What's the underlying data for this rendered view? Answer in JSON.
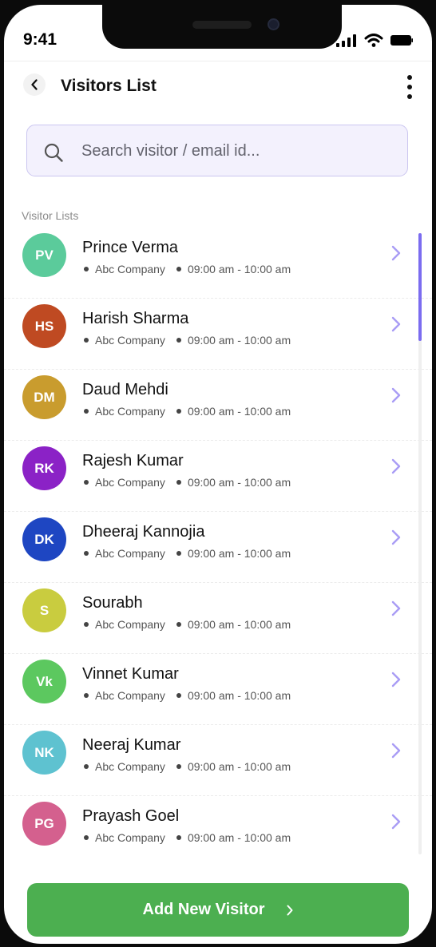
{
  "status_bar": {
    "time": "9:41"
  },
  "header": {
    "title": "Visitors List"
  },
  "search": {
    "placeholder": "Search visitor / email id..."
  },
  "section_label": "Visitor Lists",
  "visitors": [
    {
      "initials": "PV",
      "name": "Prince Verma",
      "company": "Abc Company",
      "time": "09:00 am - 10:00 am",
      "color": "#5bcb9b"
    },
    {
      "initials": "HS",
      "name": "Harish Sharma",
      "company": "Abc Company",
      "time": "09:00 am - 10:00 am",
      "color": "#bf4a22"
    },
    {
      "initials": "DM",
      "name": "Daud Mehdi",
      "company": "Abc Company",
      "time": "09:00 am - 10:00 am",
      "color": "#c99c2e"
    },
    {
      "initials": "RK",
      "name": "Rajesh Kumar",
      "company": "Abc Company",
      "time": "09:00 am - 10:00 am",
      "color": "#8b22c6"
    },
    {
      "initials": "DK",
      "name": "Dheeraj Kannojia",
      "company": "Abc Company",
      "time": "09:00 am - 10:00 am",
      "color": "#1e46c2"
    },
    {
      "initials": "S",
      "name": "Sourabh",
      "company": "Abc Company",
      "time": "09:00 am - 10:00 am",
      "color": "#c9cc3f"
    },
    {
      "initials": "Vk",
      "name": "Vinnet Kumar",
      "company": "Abc Company",
      "time": "09:00 am - 10:00 am",
      "color": "#5cc85f"
    },
    {
      "initials": "NK",
      "name": "Neeraj Kumar",
      "company": "Abc Company",
      "time": "09:00 am - 10:00 am",
      "color": "#5ec2d0"
    },
    {
      "initials": "PG",
      "name": "Prayash Goel",
      "company": "Abc Company",
      "time": "09:00 am - 10:00 am",
      "color": "#d4608e"
    }
  ],
  "cta": {
    "label": "Add New Visitor"
  },
  "colors": {
    "accent": "#7b6cf0",
    "cta": "#4caf50",
    "chevron": "#a99cf5"
  }
}
